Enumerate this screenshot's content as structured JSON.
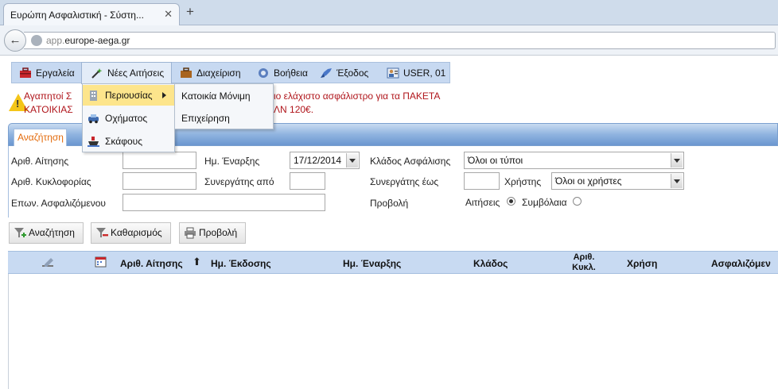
{
  "browser": {
    "tab_title": "Ευρώπη Ασφαλιστική - Σύστη...",
    "tab_close": "✕",
    "new_tab": "+",
    "url_prefix": "app.",
    "url_domain": "europe-aega.gr"
  },
  "menu": {
    "items": [
      {
        "label": "Εργαλεία",
        "icon": "toolbox-icon"
      },
      {
        "label": "Νέες Αιτήσεις",
        "icon": "magic-wand-icon"
      },
      {
        "label": "Διαχείριση",
        "icon": "briefcase-icon"
      },
      {
        "label": "Βοήθεια",
        "icon": "help-icon"
      },
      {
        "label": "Έξοδος",
        "icon": "exit-icon"
      },
      {
        "label": "USER, 01",
        "icon": "user-badge-icon"
      }
    ]
  },
  "dropdown": {
    "items": [
      {
        "label": "Περιουσίας",
        "icon": "building-icon"
      },
      {
        "label": "Οχήματος",
        "icon": "car-icon"
      },
      {
        "label": "Σκάφους",
        "icon": "boat-icon"
      }
    ],
    "submenu": [
      "Κατοικία Μόνιμη",
      "Επιχείρηση"
    ]
  },
  "warning": {
    "line1_left": "Αγαπητοί Σ",
    "line2_left": "ΚΑΤΟΙΚΙΑΣ",
    "line1_right": "ιο ελάχιστο ασφάλιστρο για τα ΠΑΚΕΤΑ",
    "line2_right": "ΛΝ 120€."
  },
  "search": {
    "tab_label": "Αναζήτηση",
    "labels": {
      "app_number": "Αριθ. Αίτησης",
      "plate": "Αριθ. Κυκλοφορίας",
      "insured_name": "Επων. Ασφαλιζόμενου",
      "start_date": "Ημ. Έναρξης",
      "partner_from": "Συνεργάτης από",
      "branch": "Κλάδος Ασφάλισης",
      "partner_to": "Συνεργάτης έως",
      "user": "Χρήστης",
      "view": "Προβολή",
      "radio_applications": "Αιτήσεις",
      "radio_contracts": "Συμβόλαια"
    },
    "values": {
      "app_number": "",
      "plate": "",
      "insured_name": "",
      "start_date": "17/12/2014",
      "partner_from": "",
      "partner_to": "",
      "branch": "Όλοι οι τύποι",
      "user": "Όλοι οι χρήστες"
    }
  },
  "actions": {
    "search": "Αναζήτηση",
    "clear": "Καθαρισμός",
    "view": "Προβολή"
  },
  "grid": {
    "columns": [
      "Αριθ. Αίτησης",
      "Ημ. Έκδοσης",
      "Ημ. Έναρξης",
      "Κλάδος",
      "Αριθ.",
      "Κυκλ.",
      "Χρήση",
      "Ασφαλιζόμεν"
    ]
  }
}
